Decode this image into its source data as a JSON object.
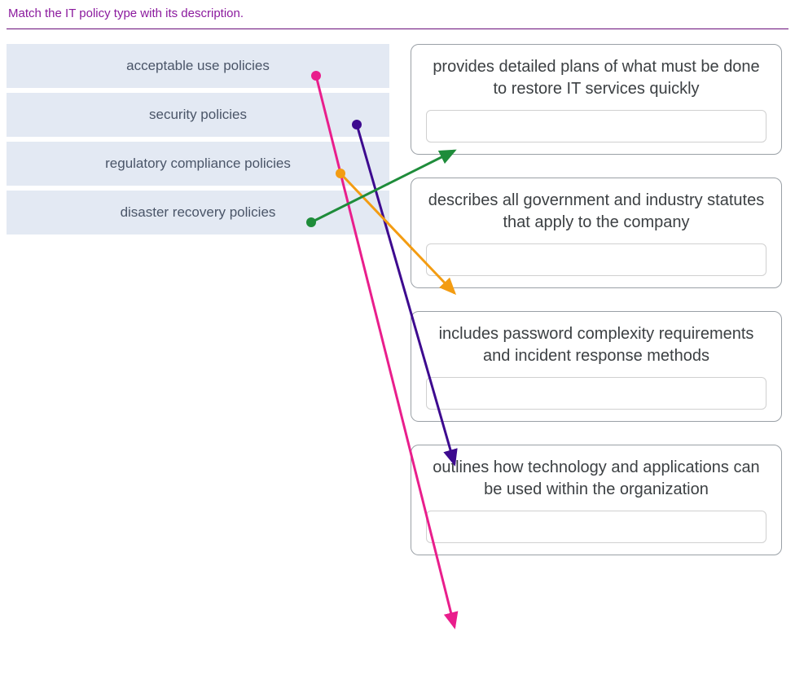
{
  "header": {
    "instruction": "Match the IT policy type with its description."
  },
  "sources": [
    {
      "label": "acceptable use policies"
    },
    {
      "label": "security policies"
    },
    {
      "label": "regulatory compliance policies"
    },
    {
      "label": "disaster recovery policies"
    }
  ],
  "targets": [
    {
      "text": "provides detailed plans of what must be done to restore IT services quickly"
    },
    {
      "text": "describes all government and industry statutes that apply to the company"
    },
    {
      "text": "includes password complexity requirements and incident response methods"
    },
    {
      "text": "outlines how technology and applications can be used within the organization"
    }
  ],
  "arrows": [
    {
      "from": 0,
      "to": 3,
      "color": "#e91e8c"
    },
    {
      "from": 1,
      "to": 2,
      "color": "#3d0a8f"
    },
    {
      "from": 2,
      "to": 1,
      "color": "#f39c12"
    },
    {
      "from": 3,
      "to": 0,
      "color": "#1e8c3a"
    }
  ]
}
